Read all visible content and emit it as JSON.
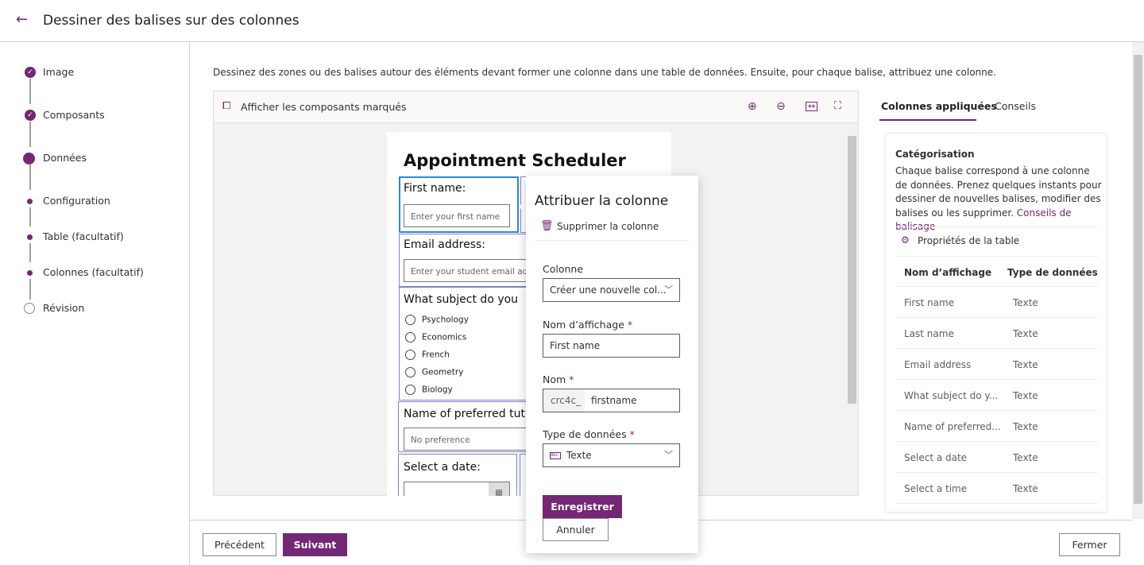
{
  "header": {
    "title": "Dessiner des balises sur des colonnes",
    "back_icon": "arrow-left-icon"
  },
  "steps": [
    {
      "label": "Image",
      "state": "completed"
    },
    {
      "label": "Composants",
      "state": "completed"
    },
    {
      "label": "Données",
      "state": "current"
    },
    {
      "label": "Configuration",
      "state": "pending-sub"
    },
    {
      "label": "Table (facultatif)",
      "state": "pending-sub"
    },
    {
      "label": "Colonnes (facultatif)",
      "state": "pending-sub"
    },
    {
      "label": "Révision",
      "state": "not-started"
    }
  ],
  "description": "Dessinez des zones ou des balises autour des éléments devant former une colonne dans une table de données. Ensuite, pour chaque balise, attribuez une colonne.",
  "toolbar": {
    "show_tagged": "Afficher les composants marqués"
  },
  "form": {
    "title": "Appointment Scheduler",
    "first_name": "First name:",
    "first_name_ph": "Enter your first name",
    "email": "Email address:",
    "email_ph": "Enter your student email ad",
    "subject": "What subject do you",
    "subjects": [
      "Psychology",
      "Economics",
      "French",
      "Geometry",
      "Biology"
    ],
    "tutor": "Name of preferred tut",
    "tutor_ph": "No preference",
    "date": "Select a date:"
  },
  "popup": {
    "title": "Attribuer la colonne",
    "delete": "Supprimer la colonne",
    "column_label": "Colonne",
    "column_value": "Créer une nouvelle col...",
    "display_label": "Nom d’affichage",
    "display_value": "First name",
    "name_label": "Nom",
    "name_prefix": "crc4c_",
    "name_value": "firstname",
    "type_label": "Type de données",
    "type_value": "Texte",
    "required": "*",
    "save": "Enregistrer",
    "cancel": "Annuler"
  },
  "right_panel": {
    "tabs": [
      {
        "label": "Colonnes appliquées",
        "active": true
      },
      {
        "label": "Conseils",
        "active": false
      }
    ],
    "heading": "Catégorisation",
    "text": "Chaque balise correspond à une colonne de données. Prenez quelques instants pour dessiner de nouvelles balises, modifier des balises ou les supprimer.",
    "link": "Conseils de balisage",
    "table_props": "Propriétés de la table",
    "col_headers": [
      "Nom d’affichage",
      "Type de données"
    ],
    "rows": [
      [
        "First name",
        "Texte"
      ],
      [
        "Last name",
        "Texte"
      ],
      [
        "Email address",
        "Texte"
      ],
      [
        "What subject do y...",
        "Texte"
      ],
      [
        "Name of preferred...",
        "Texte"
      ],
      [
        "Select a date",
        "Texte"
      ],
      [
        "Select a time",
        "Texte"
      ]
    ]
  },
  "footer": {
    "prev": "Précédent",
    "next": "Suivant",
    "close": "Fermer"
  },
  "colors": {
    "accent": "#742774",
    "tag_box": "#7986cb",
    "selected_tag": "#2b88d8"
  }
}
